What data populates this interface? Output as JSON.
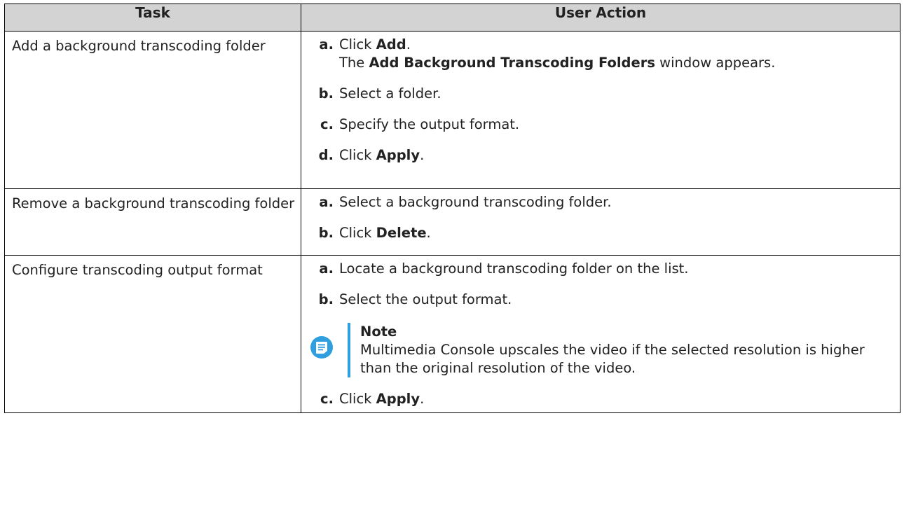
{
  "table": {
    "headers": [
      "Task",
      "User Action"
    ],
    "rows": [
      {
        "task": "Add a background transcoding folder",
        "steps": [
          {
            "letter": "a.",
            "pre": "Click ",
            "bold": "Add",
            "post": ".",
            "line2_pre": "The ",
            "line2_bold": "Add Background Transcoding Folders",
            "line2_post": " window appears."
          },
          {
            "letter": "b.",
            "text": "Select a folder."
          },
          {
            "letter": "c.",
            "text": "Specify the output format."
          },
          {
            "letter": "d.",
            "pre": "Click ",
            "bold": "Apply",
            "post": "."
          }
        ]
      },
      {
        "task": "Remove a background transcoding folder",
        "steps": [
          {
            "letter": "a.",
            "text": "Select a background transcoding folder."
          },
          {
            "letter": "b.",
            "pre": "Click ",
            "bold": "Delete",
            "post": "."
          }
        ]
      },
      {
        "task": "Configure transcoding output format",
        "steps": [
          {
            "letter": "a.",
            "text": "Locate a background transcoding folder on the list."
          },
          {
            "letter": "b.",
            "text": "Select the output format."
          },
          {
            "letter": "c.",
            "pre": "Click ",
            "bold": "Apply",
            "post": "."
          }
        ],
        "note": {
          "title": "Note",
          "text": "Multimedia Console upscales the video if the selected resolution is higher than the original resolution of the video.",
          "icon": "note-icon",
          "color": "#2f9fe0"
        }
      }
    ]
  }
}
